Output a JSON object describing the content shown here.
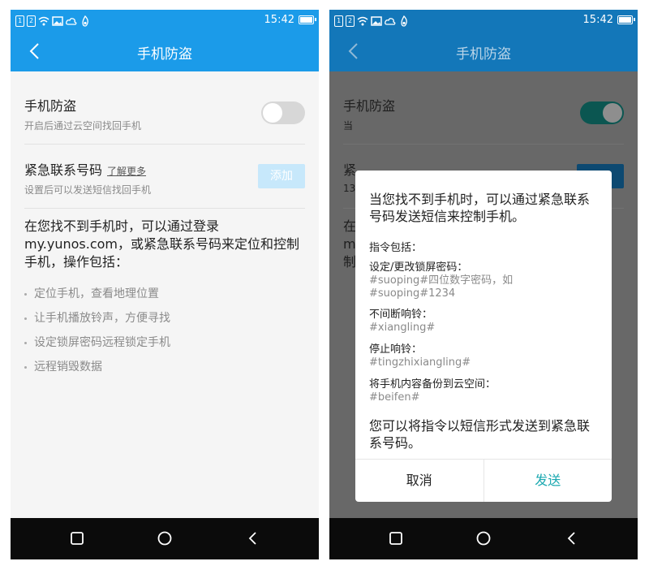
{
  "status_bar": {
    "time": "15:42",
    "sim1": "1",
    "sim2": "2"
  },
  "left": {
    "nav_title": "手机防盗",
    "anti_theft": {
      "title": "手机防盗",
      "subtitle": "开启后通过云空间找回手机",
      "enabled": false
    },
    "emergency": {
      "title": "紧急联系号码",
      "learn_more": "了解更多",
      "subtitle": "设置后可以发送短信找回手机",
      "add_label": "添加"
    },
    "description": "在您找不到手机时，可以通过登录my.yunos.com，或紧急联系号码来定位和控制手机，操作包括：",
    "bullets": [
      "定位手机，查看地理位置",
      "让手机播放铃声，方便寻找",
      "设定锁屏密码远程锁定手机",
      "远程销毁数据"
    ]
  },
  "right": {
    "nav_title": "手机防盗",
    "anti_theft": {
      "title": "手机防盗",
      "subtitle_partial": "当",
      "enabled": true
    },
    "emergency": {
      "title_partial": "紧",
      "subtitle_partial": "13"
    },
    "description_partial": "在\nm\n制",
    "dialog": {
      "intro": "当您找不到手机时，可以通过紧急联系号码发送短信来控制手机。",
      "commands_header": "指令包括：",
      "commands": [
        {
          "label": "设定/更改锁屏密码：",
          "code": "#suoping#四位数字密码，如\n#suoping#1234"
        },
        {
          "label": "不间断响铃：",
          "code": "#xiangling#"
        },
        {
          "label": "停止响铃：",
          "code": "#tingzhixiangling#"
        },
        {
          "label": "将手机内容备份到云空间：",
          "code": "#beifen#"
        }
      ],
      "footer": "您可以将指令以短信形式发送到紧急联系号码。",
      "cancel_label": "取消",
      "send_label": "发送"
    }
  },
  "colors": {
    "primary": "#1b9be9",
    "primary_dimmed": "#1377b9",
    "toggle_on": "#138c83",
    "send": "#1aa8b0"
  },
  "icons": [
    "sim-icon",
    "wifi-icon",
    "image-icon",
    "cloud-icon",
    "flame-icon",
    "battery-icon",
    "back-icon",
    "recent-apps-icon",
    "home-icon",
    "back-nav-icon"
  ]
}
